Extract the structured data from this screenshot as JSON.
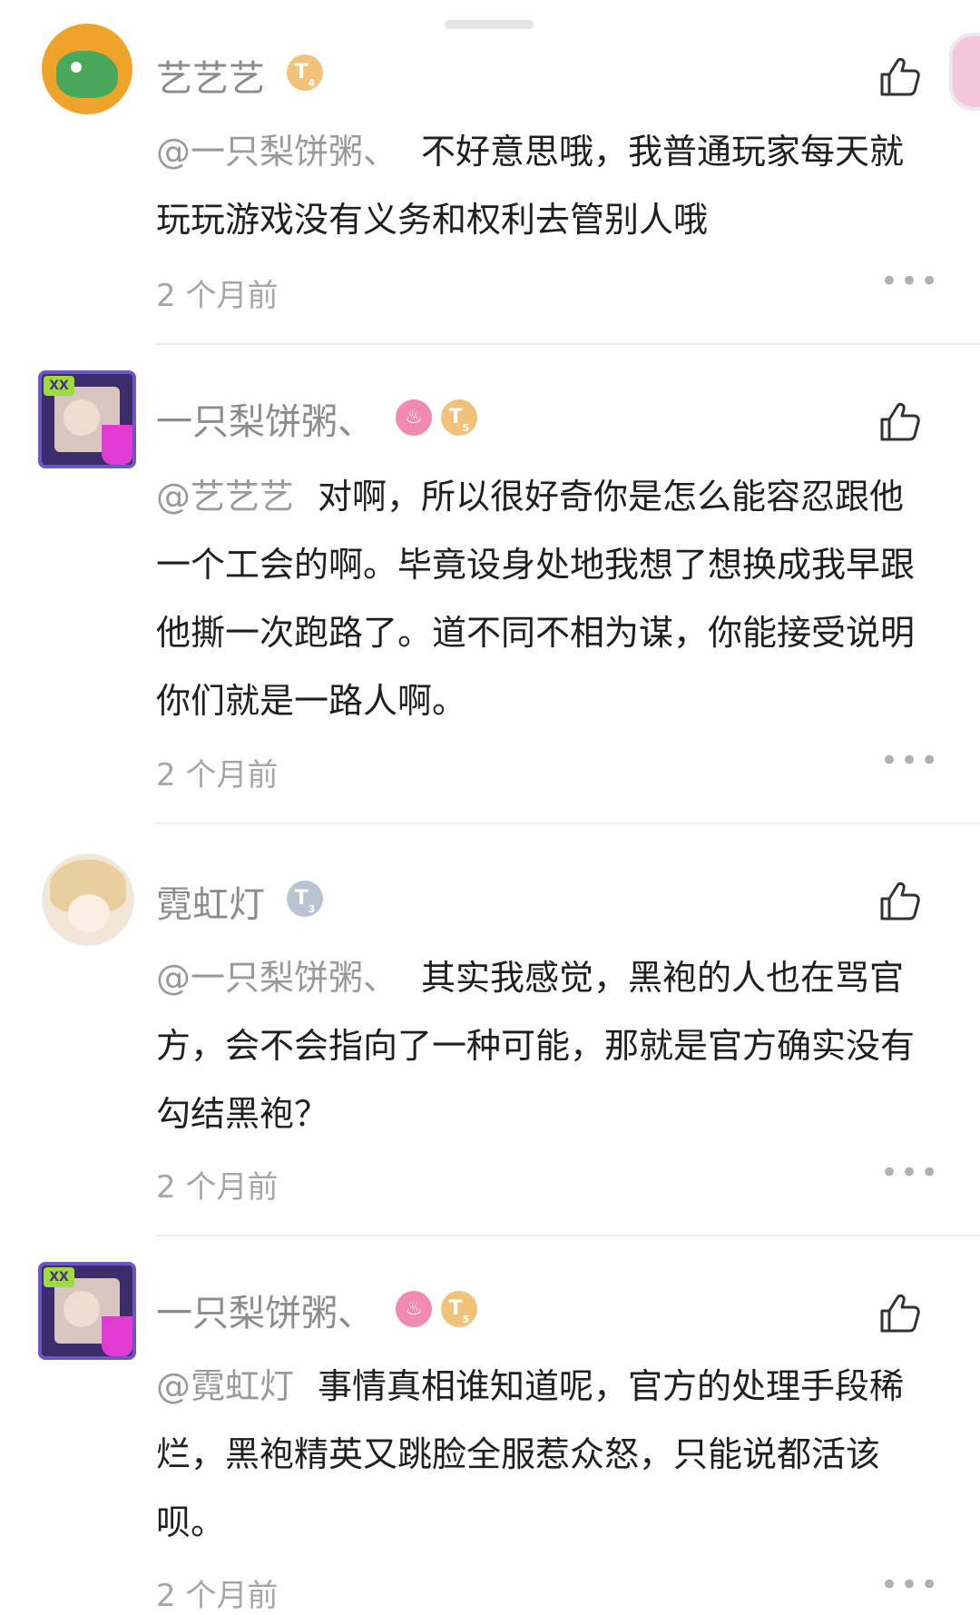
{
  "comments": [
    {
      "username": "艺艺艺",
      "badges": [
        "T4"
      ],
      "mention": "@一只梨饼粥、",
      "text": "不好意思哦，我普通玩家每天就玩玩游戏没有义务和权利去管别人哦",
      "time": "2 个月前"
    },
    {
      "username": "一只梨饼粥、",
      "badges": [
        "fire",
        "T5"
      ],
      "mention": "@艺艺艺",
      "text": "对啊，所以很好奇你是怎么能容忍跟他一个工会的啊。毕竟设身处地我想了想换成我早跟他撕一次跑路了。道不同不相为谋，你能接受说明你们就是一路人啊。",
      "time": "2 个月前"
    },
    {
      "username": "霓虹灯",
      "badges": [
        "T3"
      ],
      "mention": "@一只梨饼粥、",
      "text": "其实我感觉，黑袍的人也在骂官方，会不会指向了一种可能，那就是官方确实没有勾结黑袍？",
      "time": "2 个月前"
    },
    {
      "username": "一只梨饼粥、",
      "badges": [
        "fire",
        "T5"
      ],
      "mention": "@霓虹灯",
      "text": "事情真相谁知道呢，官方的处理手段稀烂，黑袍精英又跳脸全服惹众怒，只能说都活该呗。",
      "time": "2 个月前"
    }
  ],
  "icons": {
    "like": "thumbs-up-icon",
    "more": "more-dots-icon"
  },
  "colors": {
    "username": "#8c8c8c",
    "mention": "#9a9a9a",
    "time": "#a6a6a6"
  }
}
